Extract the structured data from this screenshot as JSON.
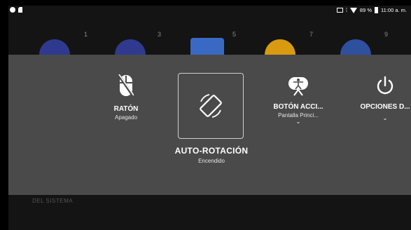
{
  "status_bar": {
    "battery_percent": "89 %",
    "time": "11:00 a. m.",
    "icons": [
      "circle-icon",
      "sim-icon",
      "screenshot-icon",
      "vibrate-icon",
      "wifi-icon",
      "battery-icon"
    ]
  },
  "background": {
    "page_numbers": [
      "1",
      "3",
      "5",
      "7",
      "9"
    ],
    "section_text": "DEL SISTEMA",
    "app_colors": [
      "#2f3a8f",
      "#2f3a8f",
      "#3a69c4",
      "#d79a10",
      "#2f4f9f"
    ]
  },
  "tiles": {
    "mouse": {
      "label": "RATÓN",
      "status": "Apagado",
      "icon": "mouse-icon"
    },
    "auto_rotation": {
      "label": "AUTO-ROTACIÓN",
      "status": "Encendido",
      "icon": "rotate-icon"
    },
    "accessibility_button": {
      "label": "BOTÓN ACCI...",
      "status": "Pantalla Princi...",
      "icon": "accessibility-button-icon",
      "chevron": "⌄"
    },
    "power_options": {
      "label": "OPCIONES D...",
      "icon": "power-icon",
      "chevron": "⌄"
    }
  },
  "colors": {
    "panel": "#4a4a4a",
    "background": "#141414"
  }
}
